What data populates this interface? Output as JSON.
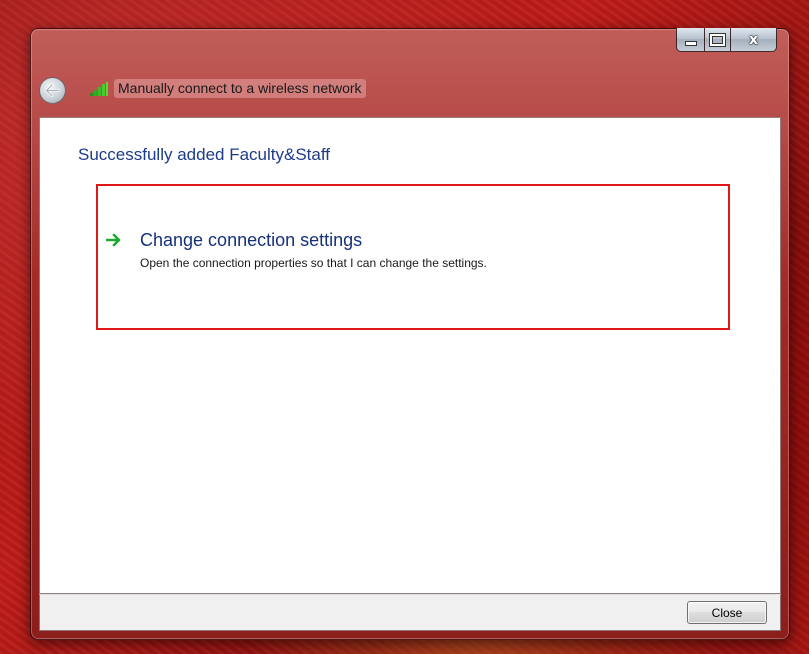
{
  "window": {
    "title": "Manually connect to a wireless network",
    "caption_buttons": {
      "minimize_icon": "minimize-icon",
      "maximize_icon": "maximize-icon",
      "close_glyph": "x"
    },
    "back_icon": "back-arrow-icon",
    "title_icon": "wireless-signal-icon"
  },
  "content": {
    "heading": "Successfully added Faculty&Staff",
    "command_link": {
      "icon": "green-arrow-icon",
      "title": "Change connection settings",
      "description": "Open the connection properties so that I can change the settings."
    }
  },
  "footer": {
    "close_label": "Close"
  },
  "colors": {
    "heading": "#1e3a8c",
    "command_title": "#16307a",
    "highlight_border": "#e01818",
    "arrow": "#1fa82b",
    "background": "#b01a16"
  }
}
